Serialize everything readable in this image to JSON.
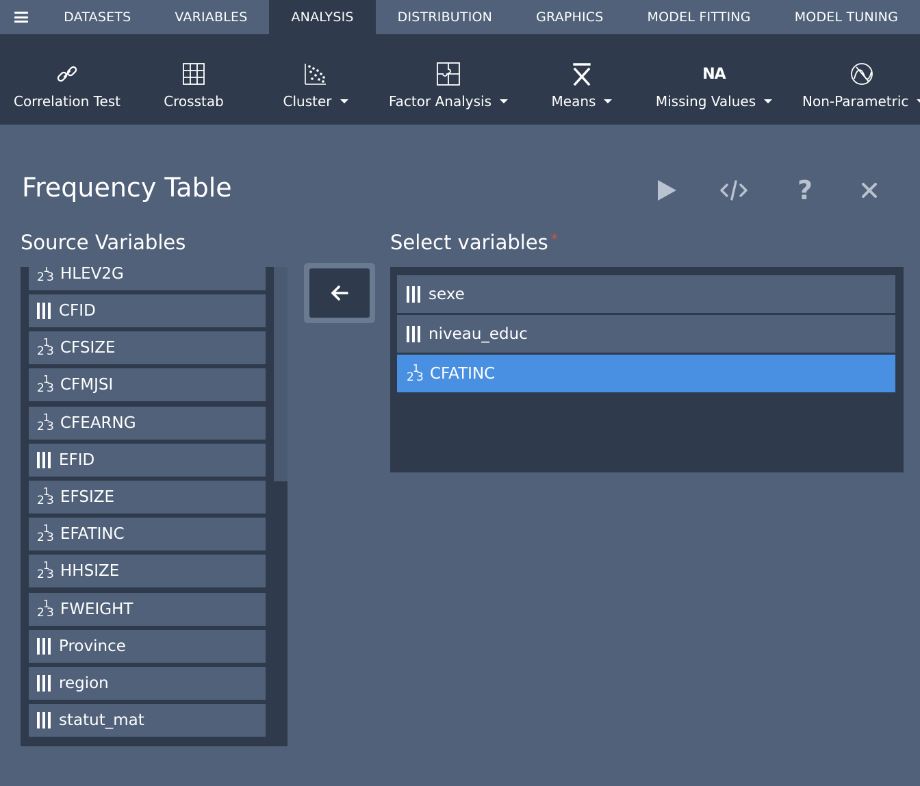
{
  "nav": {
    "tabs": [
      "DATASETS",
      "VARIABLES",
      "ANALYSIS",
      "DISTRIBUTION",
      "GRAPHICS",
      "MODEL FITTING",
      "MODEL TUNING"
    ],
    "active_tab": "ANALYSIS"
  },
  "toolbar": {
    "correlation_test": "Correlation Test",
    "crosstab": "Crosstab",
    "cluster": "Cluster",
    "factor_analysis": "Factor Analysis",
    "means": "Means",
    "missing_values": "Missing Values",
    "missing_values_icon_text": "NA",
    "non_parametric": "Non-Parametric"
  },
  "dialog": {
    "title": "Frequency Table",
    "source_label": "Source Variables",
    "target_label": "Select variables",
    "required_mark": "*"
  },
  "source_variables": [
    {
      "name": "HLEV2G",
      "type": "numeric"
    },
    {
      "name": "CFID",
      "type": "nominal"
    },
    {
      "name": "CFSIZE",
      "type": "numeric"
    },
    {
      "name": "CFMJSI",
      "type": "numeric"
    },
    {
      "name": "CFEARNG",
      "type": "numeric"
    },
    {
      "name": "EFID",
      "type": "nominal"
    },
    {
      "name": "EFSIZE",
      "type": "numeric"
    },
    {
      "name": "EFATINC",
      "type": "numeric"
    },
    {
      "name": "HHSIZE",
      "type": "numeric"
    },
    {
      "name": "FWEIGHT",
      "type": "numeric"
    },
    {
      "name": "Province",
      "type": "nominal"
    },
    {
      "name": "region",
      "type": "nominal"
    },
    {
      "name": "statut_mat",
      "type": "nominal"
    }
  ],
  "selected_variables": [
    {
      "name": "sexe",
      "type": "nominal",
      "selected": false
    },
    {
      "name": "niveau_educ",
      "type": "nominal",
      "selected": false
    },
    {
      "name": "CFATINC",
      "type": "numeric",
      "selected": true
    }
  ],
  "colors": {
    "page_bg": "#506179",
    "panel_bg": "#2f3b4c",
    "selected": "#4a90e2",
    "required": "#e0533a"
  }
}
